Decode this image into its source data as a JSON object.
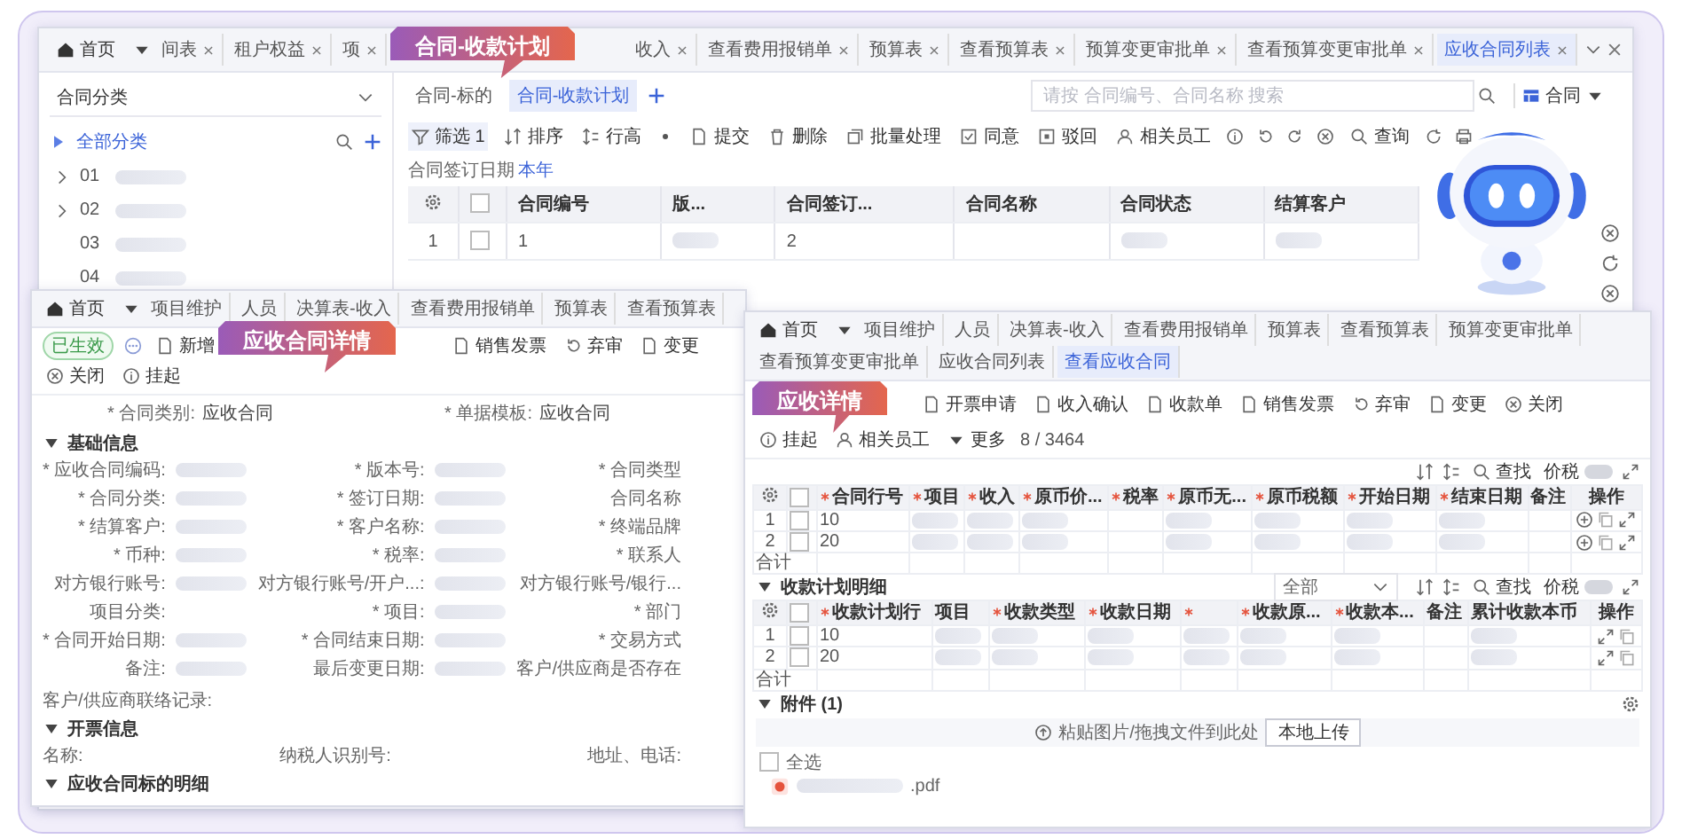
{
  "list_window": {
    "callout": "合同-收款计划",
    "home_tab": "首页",
    "tabs_before": [
      {
        "label": "间表",
        "selected": false
      },
      {
        "label": "租户权益",
        "selected": false
      },
      {
        "label": "项",
        "selected": false
      }
    ],
    "tabs_after": [
      {
        "label": "收入",
        "selected": false
      },
      {
        "label": "查看费用报销单",
        "selected": false
      },
      {
        "label": "预算表",
        "selected": false
      },
      {
        "label": "查看预算表",
        "selected": false
      },
      {
        "label": "预算变更审批单",
        "selected": false
      },
      {
        "label": "查看预算变更审批单",
        "selected": false
      },
      {
        "label": "应收合同列表",
        "selected": true
      }
    ],
    "category_select": "合同分类",
    "category_root": "全部分类",
    "categories": [
      {
        "label": "01",
        "expandable": true
      },
      {
        "label": "02",
        "expandable": true
      },
      {
        "label": "03",
        "expandable": false
      },
      {
        "label": "04",
        "expandable": false
      }
    ],
    "subtabs": [
      {
        "label": "合同-标的",
        "selected": false
      },
      {
        "label": "合同-收款计划",
        "selected": true
      }
    ],
    "search_placeholder": "请按 合同编号、合同名称 搜索",
    "view_button": "合同",
    "toolbar": [
      {
        "label": "筛选 1",
        "kind": "filter"
      },
      {
        "label": "排序",
        "kind": "sort"
      },
      {
        "label": "行高",
        "kind": "height"
      },
      {
        "kind": "separator"
      },
      {
        "label": "提交",
        "kind": "submit"
      },
      {
        "label": "删除",
        "kind": "delete"
      },
      {
        "label": "批量处理",
        "kind": "batch"
      },
      {
        "label": "同意",
        "kind": "approve"
      },
      {
        "label": "驳回",
        "kind": "reject"
      },
      {
        "label": "相关员工",
        "kind": "staff"
      },
      {
        "kind": "info"
      },
      {
        "kind": "undo"
      },
      {
        "kind": "redo"
      },
      {
        "kind": "cancel"
      },
      {
        "label": "查询",
        "kind": "search"
      },
      {
        "kind": "refresh"
      },
      {
        "kind": "print"
      }
    ],
    "filter_label": "合同签订日期",
    "filter_value": "本年",
    "columns": [
      "合同编号",
      "版...",
      "合同签订...",
      "合同名称",
      "合同状态",
      "结算客户"
    ],
    "all_checked": false,
    "rows": [
      {
        "index": "1",
        "checked": false,
        "cells": [
          "1",
          {
            "blurred": true
          },
          "2",
          {
            "blurred": false
          },
          {
            "blurred": true
          },
          {
            "blurred": true
          }
        ]
      }
    ]
  },
  "detail_window": {
    "callout": "应收合同详情",
    "home_tab": "首页",
    "tabs": [
      {
        "label": "项目维护",
        "selected": false
      },
      {
        "label": "人员",
        "selected": false
      },
      {
        "label": "决算表-收入",
        "selected": false
      },
      {
        "label": "查看费用报销单",
        "selected": false
      },
      {
        "label": "预算表",
        "selected": false
      },
      {
        "label": "查看预算表",
        "selected": false
      }
    ],
    "status": "已生效",
    "toolbar_before": [
      {
        "label": "新增",
        "kind": "new"
      }
    ],
    "toolbar_after": [
      {
        "label": "销售发票",
        "kind": "invoice"
      },
      {
        "label": "弃审",
        "kind": "undo"
      },
      {
        "label": "变更",
        "kind": "change"
      },
      {
        "label": "关闭",
        "kind": "cancel"
      },
      {
        "label": "挂起",
        "kind": "info"
      }
    ],
    "header_fields": [
      {
        "label": "* 合同类别:",
        "value": "应收合同"
      },
      {
        "label": "* 单据模板:",
        "value": "应收合同"
      }
    ],
    "sections": [
      {
        "title": "基础信息",
        "expanded": true,
        "fields": [
          {
            "label": "* 应收合同编码:",
            "blurred": true
          },
          {
            "label": "* 版本号:",
            "blurred": true
          },
          {
            "label": "* 合同类型",
            "blurred": false
          },
          {
            "label": "* 合同分类:",
            "blurred": true
          },
          {
            "label": "* 签订日期:",
            "blurred": true
          },
          {
            "label": "合同名称",
            "blurred": false
          },
          {
            "label": "* 结算客户:",
            "blurred": true
          },
          {
            "label": "* 客户名称:",
            "blurred": true
          },
          {
            "label": "* 终端品牌",
            "blurred": false
          },
          {
            "label": "* 币种:",
            "blurred": true
          },
          {
            "label": "* 税率:",
            "blurred": true
          },
          {
            "label": "* 联系人",
            "blurred": false
          },
          {
            "label": "对方银行账号:",
            "blurred": true
          },
          {
            "label": "对方银行账号/开户...:",
            "blurred": true
          },
          {
            "label": "对方银行账号/银行...",
            "blurred": false
          },
          {
            "label": "项目分类:",
            "blurred": false
          },
          {
            "label": "* 项目:",
            "blurred": true
          },
          {
            "label": "* 部门",
            "blurred": false
          },
          {
            "label": "* 合同开始日期:",
            "blurred": true
          },
          {
            "label": "* 合同结束日期:",
            "blurred": true
          },
          {
            "label": "* 交易方式",
            "blurred": false
          },
          {
            "label": "备注:",
            "blurred": true
          },
          {
            "label": "最后变更日期:",
            "blurred": true
          },
          {
            "label": "客户/供应商是否存在",
            "blurred": false
          }
        ],
        "note": "客户/供应商联络记录:"
      },
      {
        "title": "开票信息",
        "expanded": true,
        "fields": [
          {
            "label": "名称:",
            "blurred": false
          },
          {
            "label": "纳税人识别号:",
            "blurred": false
          },
          {
            "label": "地址、电话:",
            "blurred": false
          }
        ]
      },
      {
        "title": "应收合同标的明细",
        "expanded": true
      }
    ]
  },
  "receivable_window": {
    "callout": "应收详情",
    "home_tab": "首页",
    "tabs": [
      {
        "label": "项目维护",
        "selected": false
      },
      {
        "label": "人员",
        "selected": false
      },
      {
        "label": "决算表-收入",
        "selected": false
      },
      {
        "label": "查看费用报销单",
        "selected": false
      },
      {
        "label": "预算表",
        "selected": false
      },
      {
        "label": "查看预算表",
        "selected": false
      },
      {
        "label": "预算变更审批单",
        "selected": false
      },
      {
        "label": "查看预算变更审批单",
        "selected": false
      },
      {
        "label": "应收合同列表",
        "selected": false
      },
      {
        "label": "查看应收合同",
        "selected": true
      }
    ],
    "toolbar": [
      {
        "label": "开票申请",
        "kind": "invoice"
      },
      {
        "label": "收入确认",
        "kind": "confirm"
      },
      {
        "label": "收款单",
        "kind": "receipt"
      },
      {
        "label": "销售发票",
        "kind": "invoice"
      },
      {
        "label": "弃审",
        "kind": "undo"
      },
      {
        "label": "变更",
        "kind": "change"
      },
      {
        "label": "关闭",
        "kind": "cancel"
      },
      {
        "label": "挂起",
        "kind": "info"
      },
      {
        "label": "相关员工",
        "kind": "staff"
      },
      {
        "label": "更多",
        "kind": "more"
      }
    ],
    "pager": "8 / 3464",
    "lines": {
      "search": "查找",
      "tax_toggle": {
        "label": "价税",
        "on": false
      },
      "actions_label": "操作",
      "total": "合计",
      "all_checked": false,
      "columns": [
        {
          "label": "合同行号",
          "required": true
        },
        {
          "label": "项目",
          "required": true
        },
        {
          "label": "收入",
          "required": true
        },
        {
          "label": "原币价...",
          "required": true
        },
        {
          "label": "税率",
          "required": true
        },
        {
          "label": "原币无...",
          "required": true
        },
        {
          "label": "原币税额",
          "required": true
        },
        {
          "label": "开始日期",
          "required": true
        },
        {
          "label": "结束日期",
          "required": true
        },
        {
          "label": "备注",
          "required": false
        }
      ],
      "rows": [
        {
          "index": "1",
          "checked": false,
          "cells": [
            "10",
            {
              "blurred": true
            },
            {
              "blurred": true
            },
            {
              "blurred": true
            },
            {
              "blurred": false
            },
            {
              "blurred": true
            },
            {
              "blurred": true
            },
            {
              "blurred": true
            },
            {
              "blurred": true
            },
            {
              "blurred": false
            }
          ]
        },
        {
          "index": "2",
          "checked": false,
          "cells": [
            "20",
            {
              "blurred": true
            },
            {
              "blurred": true
            },
            {
              "blurred": true
            },
            {
              "blurred": false
            },
            {
              "blurred": true
            },
            {
              "blurred": true
            },
            {
              "blurred": true
            },
            {
              "blurred": true
            },
            {
              "blurred": false
            }
          ]
        }
      ]
    },
    "plan": {
      "title": "收款计划明细",
      "expanded": true,
      "filter": "全部",
      "search": "查找",
      "tax_toggle": {
        "label": "价税",
        "on": false
      },
      "actions_label": "操作",
      "total": "合计",
      "all_checked": false,
      "columns": [
        {
          "label": "收款计划行",
          "required": true
        },
        {
          "label": "项目",
          "required": false
        },
        {
          "label": "收款类型",
          "required": true
        },
        {
          "label": "收款日期",
          "required": true
        },
        {
          "required": true
        },
        {
          "label": "收款原...",
          "required": true
        },
        {
          "label": "收款本...",
          "required": true
        },
        {
          "label": "备注",
          "required": false
        },
        {
          "label": "累计收款本币",
          "required": false
        }
      ],
      "rows": [
        {
          "index": "1",
          "checked": false,
          "cells": [
            "10",
            {
              "blurred": true
            },
            {
              "blurred": true
            },
            {
              "blurred": true
            },
            {
              "blurred": true
            },
            {
              "blurred": true
            },
            {
              "blurred": true
            },
            {
              "blurred": false
            },
            {
              "blurred": true
            }
          ]
        },
        {
          "index": "2",
          "checked": false,
          "cells": [
            "20",
            {
              "blurred": true
            },
            {
              "blurred": true
            },
            {
              "blurred": true
            },
            {
              "blurred": true
            },
            {
              "blurred": true
            },
            {
              "blurred": true
            },
            {
              "blurred": false
            },
            {
              "blurred": true
            }
          ]
        }
      ]
    },
    "attachments": {
      "title": "附件 (1)",
      "expanded": true,
      "hint": "粘贴图片/拖拽文件到此处",
      "upload_button": "本地上传",
      "select_all": {
        "label": "全选",
        "checked": false
      },
      "files": [
        {
          "name": ".pdf"
        }
      ]
    }
  }
}
